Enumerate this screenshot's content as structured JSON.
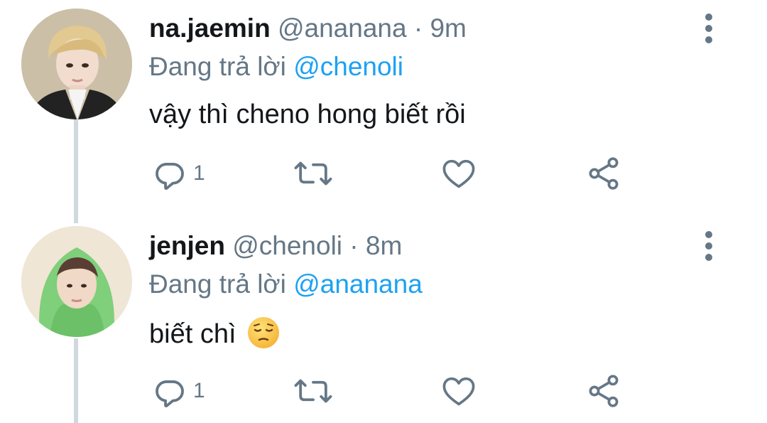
{
  "tweets": [
    {
      "display_name": "na.jaemin",
      "handle": "@ananana",
      "separator": "·",
      "time": "9m",
      "reply_prefix": "Đang trả lời",
      "reply_to": "@chenoli",
      "text": "vậy thì cheno hong biết rồi",
      "emoji": "",
      "reply_count": "1",
      "icons": [
        "reply-icon",
        "retweet-icon",
        "like-icon",
        "share-icon",
        "more-vertical-icon"
      ]
    },
    {
      "display_name": "jenjen",
      "handle": "@chenoli",
      "separator": "·",
      "time": "8m",
      "reply_prefix": "Đang trả lời",
      "reply_to": "@ananana",
      "text": "biết chì",
      "emoji": "pensive-face",
      "reply_count": "1",
      "icons": [
        "reply-icon",
        "retweet-icon",
        "like-icon",
        "share-icon",
        "more-vertical-icon"
      ]
    }
  ],
  "colors": {
    "text_primary": "#14171a",
    "text_secondary": "#657786",
    "link": "#1da1f2",
    "thread_line": "#cfd9de",
    "icon": "#657786"
  }
}
